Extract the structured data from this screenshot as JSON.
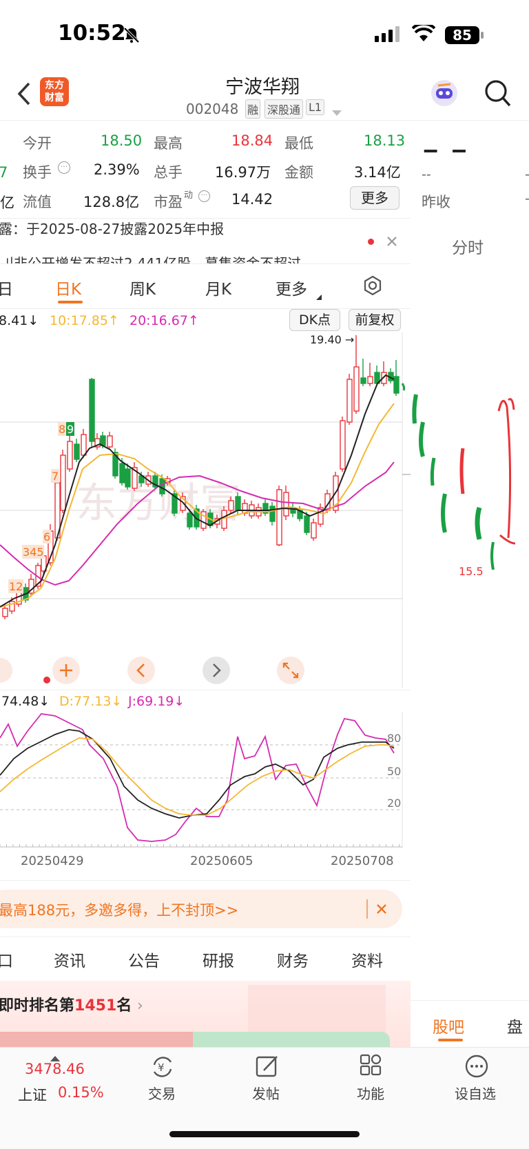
{
  "status": {
    "time": "10:52",
    "battery": "85"
  },
  "header": {
    "logo_line1": "东方",
    "logo_line2": "财富",
    "stock_name": "宁波华翔",
    "code": "002048",
    "tag_margin": "融",
    "tag_connect": "深股通",
    "tag_level": "L1"
  },
  "quote": {
    "open_label": "今开",
    "open": "18.50",
    "high_label": "最高",
    "high": "18.84",
    "low_label": "最低",
    "low": "18.13",
    "turnover_label": "换手",
    "turnover": "2.39%",
    "volume_label": "总手",
    "volume": "16.97万",
    "amount_label": "金额",
    "amount": "3.14亿",
    "float_label": "流值",
    "float_value": "128.8亿",
    "pe_label": "市盈",
    "pe_sup": "动",
    "pe": "14.42",
    "more_label": "更多",
    "left_edge_1": "7",
    "left_edge_2": "亿",
    "side_dash": "--",
    "side_dash2": "--",
    "side_prev_label": "昨收"
  },
  "notice": {
    "line1": "露：于2025-08-27披露2025年中报",
    "line2": "刂非公开增发不超过2.441亿股，募集资金不超过..."
  },
  "tabs": {
    "prev": "日",
    "daily": "日K",
    "weekly": "周K",
    "monthly": "月K",
    "more": "更多",
    "side_intraday": "分时"
  },
  "ma_legend": {
    "ma5": "8.41",
    "ma10": "10:17.85",
    "ma20": "20:16.67",
    "dk_button": "DK点",
    "fq_button": "前复权"
  },
  "kline_labels": {
    "peak": "19.40",
    "marks": [
      "8",
      "9",
      "7",
      "6",
      "345",
      "12"
    ],
    "watermark": "东方财富",
    "hand_note": "15.5"
  },
  "kdj_legend": {
    "k": "74.48",
    "d": "D:77.13",
    "j": "J:69.19",
    "level80": "80",
    "level50": "50",
    "level20": "20"
  },
  "dates": [
    "20250429",
    "20250605",
    "20250708"
  ],
  "banner": {
    "text": "最高188元，多邀多得，上不封顶>>"
  },
  "bottom_tabs": {
    "t0": "口",
    "t1": "资讯",
    "t2": "公告",
    "t3": "研报",
    "t4": "财务",
    "t5": "资料",
    "side_active": "股吧",
    "side_next": "盘"
  },
  "rank": {
    "prefix": "即时排名第",
    "num": "1451",
    "suffix": "名"
  },
  "nav": {
    "index_value": "3478.46",
    "index_name": "上证",
    "index_change": "0.15%",
    "trade": "交易",
    "post": "发帖",
    "functions": "功能",
    "watchlist": "设自选"
  },
  "colors": {
    "up": "#e8343a",
    "down": "#1aa043",
    "accent": "#f07522",
    "ma10": "#f5b731",
    "ma20": "#d42bb0"
  }
}
